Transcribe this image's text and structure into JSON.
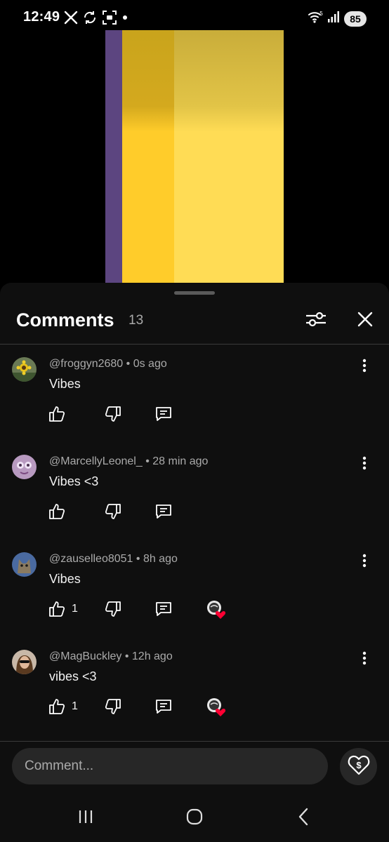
{
  "status_bar": {
    "time": "12:49",
    "battery": "85",
    "icons": [
      "x-logo-icon",
      "sync-icon",
      "screenshot-icon",
      "dot-icon",
      "wifi-icon",
      "signal-icon",
      "battery-icon"
    ]
  },
  "comments_panel": {
    "title": "Comments",
    "count": "13",
    "filter_icon": "sliders-icon",
    "close_icon": "close-icon"
  },
  "comments": [
    {
      "author": "@froggyn2680",
      "time": "0s ago",
      "text": "Vibes",
      "likes": "",
      "creator_heart": false,
      "avatar": "sunflower"
    },
    {
      "author": "@MarcellyLeonel_",
      "time": "28 min ago",
      "text": "Vibes <3",
      "likes": "",
      "creator_heart": false,
      "avatar": "purple"
    },
    {
      "author": "@zauselleo8051",
      "time": "8h ago",
      "text": "Vibes",
      "likes": "1",
      "creator_heart": true,
      "avatar": "cat"
    },
    {
      "author": "@MagBuckley",
      "time": "12h ago",
      "text": "vibes <3",
      "likes": "1",
      "creator_heart": true,
      "avatar": "person"
    }
  ],
  "composer": {
    "placeholder": "Comment...",
    "thanks_icon": "super-thanks-icon"
  },
  "nav": [
    "recent-apps-icon",
    "home-icon",
    "back-icon"
  ],
  "colors": {
    "background": "#0f0f0f",
    "muted_text": "#aaaaaa",
    "input_bg": "#272727",
    "video_purple": "#5c4580",
    "video_yellow": "#ffcc2a",
    "heart_red": "#ff0033"
  }
}
